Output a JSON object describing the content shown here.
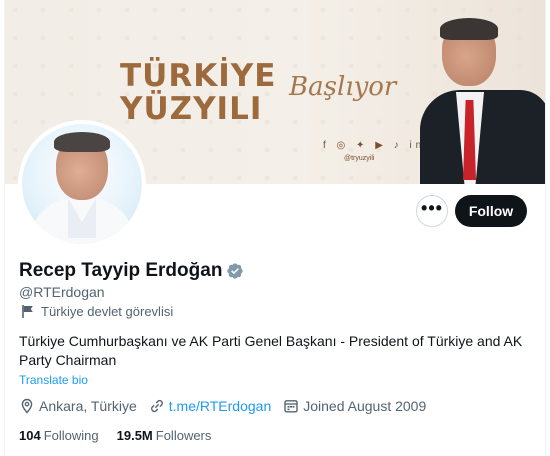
{
  "banner": {
    "title_line1": "TÜRKİYE",
    "title_line2": "YÜZYILI",
    "script": "Başlıyor",
    "social_icons": [
      "facebook-icon",
      "instagram-icon",
      "twitter-icon",
      "youtube-icon",
      "tiktok-icon",
      "linkedin-icon"
    ],
    "social_glyphs": "f ◎ ✦ ▶ ♪ in",
    "social_handle": "@tryuzyili",
    "colors": {
      "title": "#9c6a3c",
      "background": "#f2ede6"
    }
  },
  "actions": {
    "more_label": "•••",
    "follow_label": "Follow"
  },
  "profile": {
    "name": "Recep Tayyip Erdoğan",
    "handle": "@RTErdogan",
    "affiliation": "Türkiye devlet görevlisi",
    "bio": "Türkiye Cumhurbaşkanı ve AK Parti Genel Başkanı - President of Türkiye and AK Party Chairman",
    "translate_label": "Translate bio",
    "location": "Ankara, Türkiye",
    "website": "t.me/RTErdogan",
    "joined": "Joined August 2009",
    "following_count": "104",
    "following_label": "Following",
    "followers_count": "19.5M",
    "followers_label": "Followers"
  },
  "colors": {
    "accent": "#1d9bf0",
    "text_primary": "#0f1419",
    "text_secondary": "#536471",
    "verified": "#829aab"
  }
}
